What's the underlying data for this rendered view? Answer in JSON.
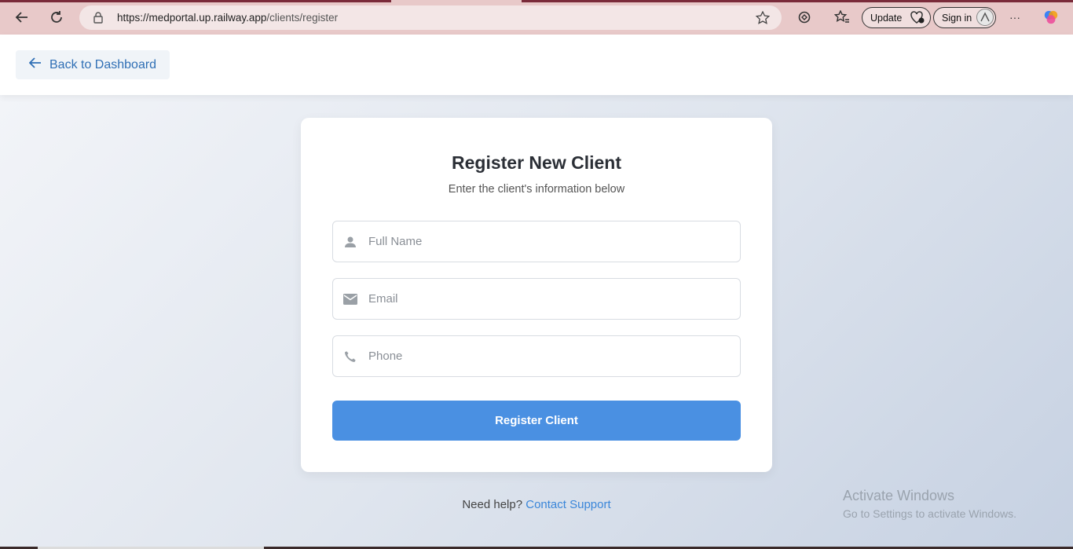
{
  "browser": {
    "url_host": "https://medportal.up.railway.app",
    "url_path": "/clients/register",
    "update_label": "Update",
    "signin_label": "Sign in",
    "more_label": "···"
  },
  "header": {
    "back_label": "Back to Dashboard"
  },
  "form": {
    "title": "Register New Client",
    "subtitle": "Enter the client's information below",
    "fields": [
      {
        "icon": "person-icon",
        "placeholder": "Full Name",
        "value": ""
      },
      {
        "icon": "mail-icon",
        "placeholder": "Email",
        "value": ""
      },
      {
        "icon": "phone-icon",
        "placeholder": "Phone",
        "value": ""
      }
    ],
    "submit_label": "Register Client"
  },
  "help": {
    "text": "Need help?",
    "link": "Contact Support"
  },
  "watermark": {
    "title": "Activate Windows",
    "subtitle": "Go to Settings to activate Windows."
  },
  "colors": {
    "accent": "#4a90e2",
    "link": "#3a86d9",
    "back_link": "#2f6fb5"
  }
}
